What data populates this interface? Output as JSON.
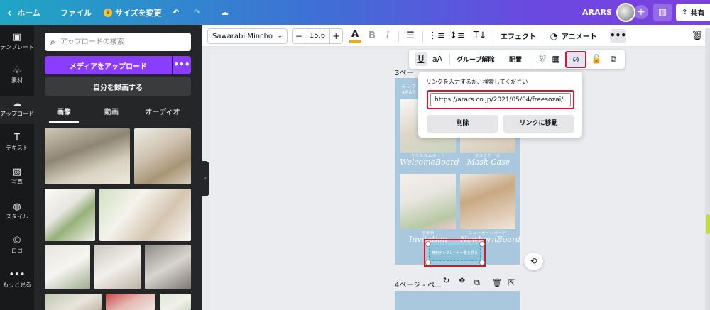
{
  "topbar": {
    "home_label": "ホーム",
    "file_label": "ファイル",
    "resize_label": "サイズを変更",
    "username": "ARARS",
    "share_label": "共有"
  },
  "rail": [
    {
      "icon": "template-icon",
      "glyph": "▣",
      "label": "テンプレート"
    },
    {
      "icon": "elements-icon",
      "glyph": "♧",
      "label": "素材"
    },
    {
      "icon": "upload-icon",
      "glyph": "☁",
      "label": "アップロード"
    },
    {
      "icon": "text-icon",
      "glyph": "T",
      "label": "テキスト"
    },
    {
      "icon": "photo-icon",
      "glyph": "▨",
      "label": "写真"
    },
    {
      "icon": "style-icon",
      "glyph": "◍",
      "label": "スタイル"
    },
    {
      "icon": "logo-icon",
      "glyph": "©",
      "label": "ロゴ"
    },
    {
      "icon": "more-icon",
      "glyph": "•••",
      "label": "もっと見る"
    }
  ],
  "panel": {
    "search_placeholder": "アップロードの検索",
    "upload_label": "メディアをアップロード",
    "record_label": "自分を録画する",
    "tabs": [
      "画像",
      "動画",
      "オーディオ"
    ]
  },
  "toolbar": {
    "font": "Sawarabi Mincho",
    "font_size": "15.6",
    "effects_label": "エフェクト",
    "animate_label": "アニメート"
  },
  "floating_toolbar": {
    "case_label": "aA",
    "ungroup_label": "グループ解除",
    "arrange_label": "配置"
  },
  "link_popup": {
    "title": "リンクを入力するか、検索してください",
    "url_value": "https://arars.co.jp/2021/05/04/freesozai/",
    "delete_label": "削除",
    "go_label": "リンクに移動"
  },
  "canvas": {
    "page3_label": "3ペー",
    "page4_label": "4ページ - ペ...",
    "cards": [
      {
        "script": "WelcomeBoard",
        "jp": "ウエルカムボード"
      },
      {
        "script": "Mask Case",
        "jp": "マスクケース"
      },
      {
        "script": "Invitation",
        "jp": "招待状"
      },
      {
        "script": "NewbornBoard",
        "jp": "ニューボーンボード"
      }
    ],
    "page_header_jp": "テンプ",
    "page_header_en": "ARAR",
    "button_text": "無料テンプレート一覧を見る"
  },
  "colors": {
    "accent_purple": "#8b3dff",
    "highlight_red": "#d0192d",
    "canvas_page_blue": "#a9c8dd"
  }
}
